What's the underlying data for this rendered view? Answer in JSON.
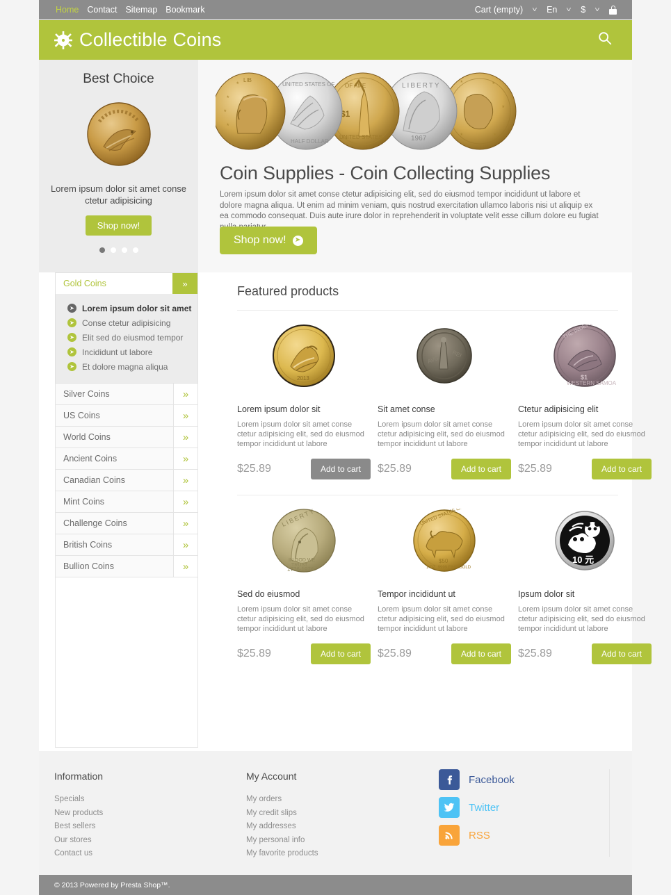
{
  "topbar": {
    "links": [
      {
        "label": "Home",
        "active": true
      },
      {
        "label": "Contact",
        "active": false
      },
      {
        "label": "Sitemap",
        "active": false
      },
      {
        "label": "Bookmark",
        "active": false
      }
    ],
    "cart": "Cart (empty)",
    "language": "En",
    "currency": "$",
    "lock_icon": "lock-icon"
  },
  "header": {
    "brand": "Collectible Coins",
    "logo_icon": "starburst-logo-icon",
    "search_icon": "search-icon"
  },
  "best_choice": {
    "title": "Best Choice",
    "caption": "Lorem ipsum dolor sit amet conse ctetur adipisicing",
    "button": "Shop now!",
    "dots": 4,
    "active_dot": 0
  },
  "banner": {
    "heading": "Coin Supplies - Coin Collecting Supplies",
    "paragraph": "Lorem ipsum dolor sit amet conse ctetur adipisicing elit, sed do eiusmod tempor incididunt ut labore et dolore magna aliqua. Ut enim ad minim veniam, quis nostrud exercitation ullamco laboris nisi ut aliquip ex ea commodo consequat. Duis aute irure dolor in reprehenderit in voluptate velit esse cillum dolore eu fugiat nulla pariatur.",
    "button": "Shop  now!"
  },
  "categories": {
    "active": {
      "label": "Gold Coins",
      "toggle_icon": "chevron-double-down-icon",
      "children": [
        {
          "label": "Lorem ipsum dolor sit amet",
          "current": true
        },
        {
          "label": "Conse ctetur adipisicing",
          "current": false
        },
        {
          "label": "Elit sed do eiusmod tempor",
          "current": false
        },
        {
          "label": "Incididunt ut labore",
          "current": false
        },
        {
          "label": "Et dolore magna aliqua",
          "current": false
        }
      ]
    },
    "items": [
      {
        "label": "Silver Coins"
      },
      {
        "label": "US Coins"
      },
      {
        "label": "World Coins"
      },
      {
        "label": "Ancient Coins"
      },
      {
        "label": "Canadian Coins"
      },
      {
        "label": "Mint Coins"
      },
      {
        "label": "Challenge Coins"
      },
      {
        "label": "British Coins"
      },
      {
        "label": "Bullion Coins"
      }
    ],
    "expand_icon": "chevron-double-right-icon"
  },
  "featured": {
    "title": "Featured products",
    "products": [
      {
        "name": "Lorem ipsum dolor sit",
        "description": "Lorem ipsum dolor sit amet conse ctetur adipisicing elit, sed do eiusmod tempor incididunt ut labore",
        "price": "$25.89",
        "cart_label": "Add to cart",
        "cart_hover": true,
        "image": "gold-sovereign-coin"
      },
      {
        "name": "Sit amet conse",
        "description": "Lorem ipsum dolor sit amet conse ctetur adipisicing elit, sed do eiusmod tempor incididunt ut labore",
        "price": "$25.89",
        "cart_label": "Add to cart",
        "cart_hover": false,
        "image": "ancient-bronze-coin"
      },
      {
        "name": "Ctetur adipisicing elit",
        "description": "Lorem ipsum dolor sit amet conse ctetur adipisicing elit, sed do eiusmod tempor incididunt ut labore",
        "price": "$25.89",
        "cart_label": "Add to cart",
        "cart_hover": false,
        "image": "western-samoa-dollar-coin"
      },
      {
        "name": "Sed do eiusmod",
        "description": "Lorem ipsum dolor sit amet conse ctetur adipisicing elit, sed do eiusmod tempor incididunt ut labore",
        "price": "$25.89",
        "cart_label": "Add to cart",
        "cart_hover": false,
        "image": "eisenhower-liberty-dollar-coin"
      },
      {
        "name": "Tempor incididunt ut",
        "description": "Lorem ipsum dolor sit amet conse ctetur adipisicing elit, sed do eiusmod tempor incididunt ut labore",
        "price": "$25.89",
        "cart_label": "Add to cart",
        "cart_hover": false,
        "image": "gold-buffalo-coin"
      },
      {
        "name": "Ipsum dolor sit",
        "description": "Lorem ipsum dolor sit amet conse ctetur adipisicing elit, sed do eiusmod tempor incididunt ut labore",
        "price": "$25.89",
        "cart_label": "Add to cart",
        "cart_hover": false,
        "image": "silver-panda-coin"
      }
    ]
  },
  "footer": {
    "information": {
      "title": "Information",
      "links": [
        "Specials",
        "New products",
        "Best sellers",
        "Our stores",
        "Contact us"
      ]
    },
    "my_account": {
      "title": "My Account",
      "links": [
        "My orders",
        "My credit slips",
        "My addresses",
        "My personal info",
        "My favorite products"
      ]
    },
    "social": [
      {
        "label": "Facebook",
        "icon": "facebook-icon",
        "color": "#3b5998"
      },
      {
        "label": "Twitter",
        "icon": "twitter-icon",
        "color": "#4ec3f5"
      },
      {
        "label": "RSS",
        "icon": "rss-icon",
        "color": "#f9a43a"
      }
    ]
  },
  "copyright": "© 2013 Powered by Presta Shop™."
}
